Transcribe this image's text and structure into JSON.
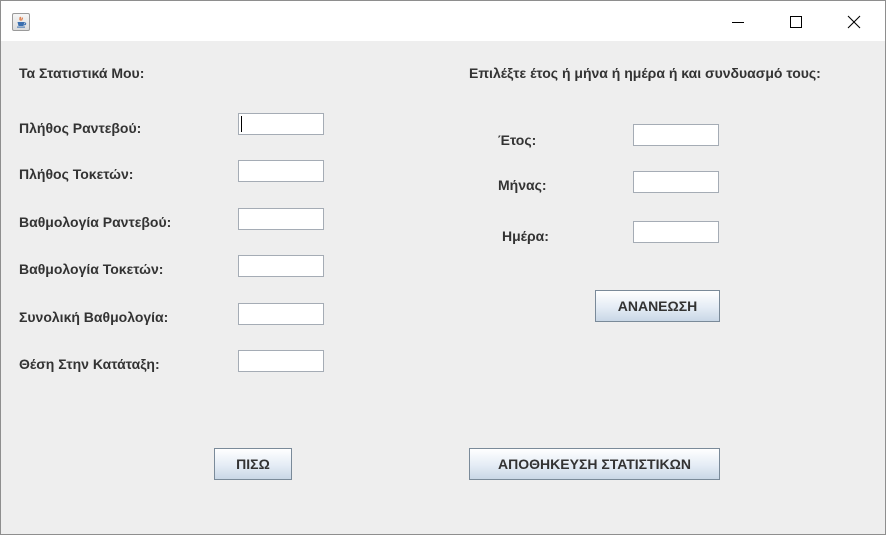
{
  "window": {
    "icon": "java-cup-icon",
    "controls": {
      "minimize": "minimize-icon",
      "maximize": "maximize-icon",
      "close": "close-icon"
    }
  },
  "stats": {
    "title": "Τα Στατιστικά Μου:",
    "appointments_label": "Πλήθος Ραντεβού:",
    "appointments_value": "",
    "births_label": "Πλήθος Τοκετών:",
    "births_value": "",
    "appointment_rating_label": "Βαθμολογία Ραντεβού:",
    "appointment_rating_value": "",
    "birth_rating_label": "Βαθμολογία Τοκετών:",
    "birth_rating_value": "",
    "total_rating_label": "Συνολική Βαθμολογία:",
    "total_rating_value": "",
    "ranking_label": "Θέση Στην Κατάταξη:",
    "ranking_value": ""
  },
  "filter": {
    "title": "Επιλέξτε έτος ή μήνα ή ημέρα ή και συνδυασμό τους:",
    "year_label": "Έτος:",
    "year_value": "",
    "month_label": "Μήνας:",
    "month_value": "",
    "day_label": "Ημέρα:",
    "day_value": "",
    "refresh_button": "ΑΝΑΝΕΩΣΗ"
  },
  "buttons": {
    "back": "ΠΙΣΩ",
    "save_stats": "ΑΠΟΘΗΚΕΥΣΗ ΣΤΑΤΙΣΤΙΚΩΝ"
  }
}
